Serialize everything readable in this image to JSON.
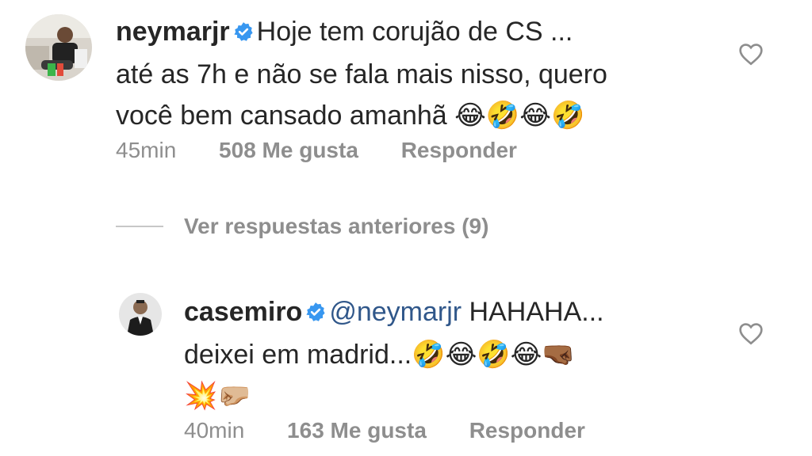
{
  "comments": [
    {
      "username": "neymarjr",
      "verified": true,
      "text_line1": "Hoje tem corujão de CS ...",
      "text_line2": "até as 7h e não se fala mais nisso, quero",
      "text_line3": "você bem cansado amanhã",
      "emojis_line3": [
        "😂",
        "🤣",
        "😂",
        "🤣"
      ],
      "time": "45min",
      "likes": "508 Me gusta",
      "reply_label": "Responder",
      "like_icon": "heart-outline-icon"
    },
    {
      "username": "casemiro",
      "verified": true,
      "mention": "@neymarjr",
      "text_line1": "HAHAHA...",
      "text_line2": "deixei em madrid...",
      "emojis_line2": [
        "🤣",
        "😂",
        "🤣",
        "😂",
        "🤜🏾"
      ],
      "emojis_line3": [
        "💥",
        "🤛🏼"
      ],
      "time": "40min",
      "likes": "163 Me gusta",
      "reply_label": "Responder",
      "like_icon": "heart-outline-icon"
    }
  ],
  "view_replies": {
    "label": "Ver respuestas anteriores (9)"
  },
  "colors": {
    "text": "#262626",
    "secondary": "#8e8e8e",
    "verified": "#3897f0",
    "mention": "#30578a"
  }
}
